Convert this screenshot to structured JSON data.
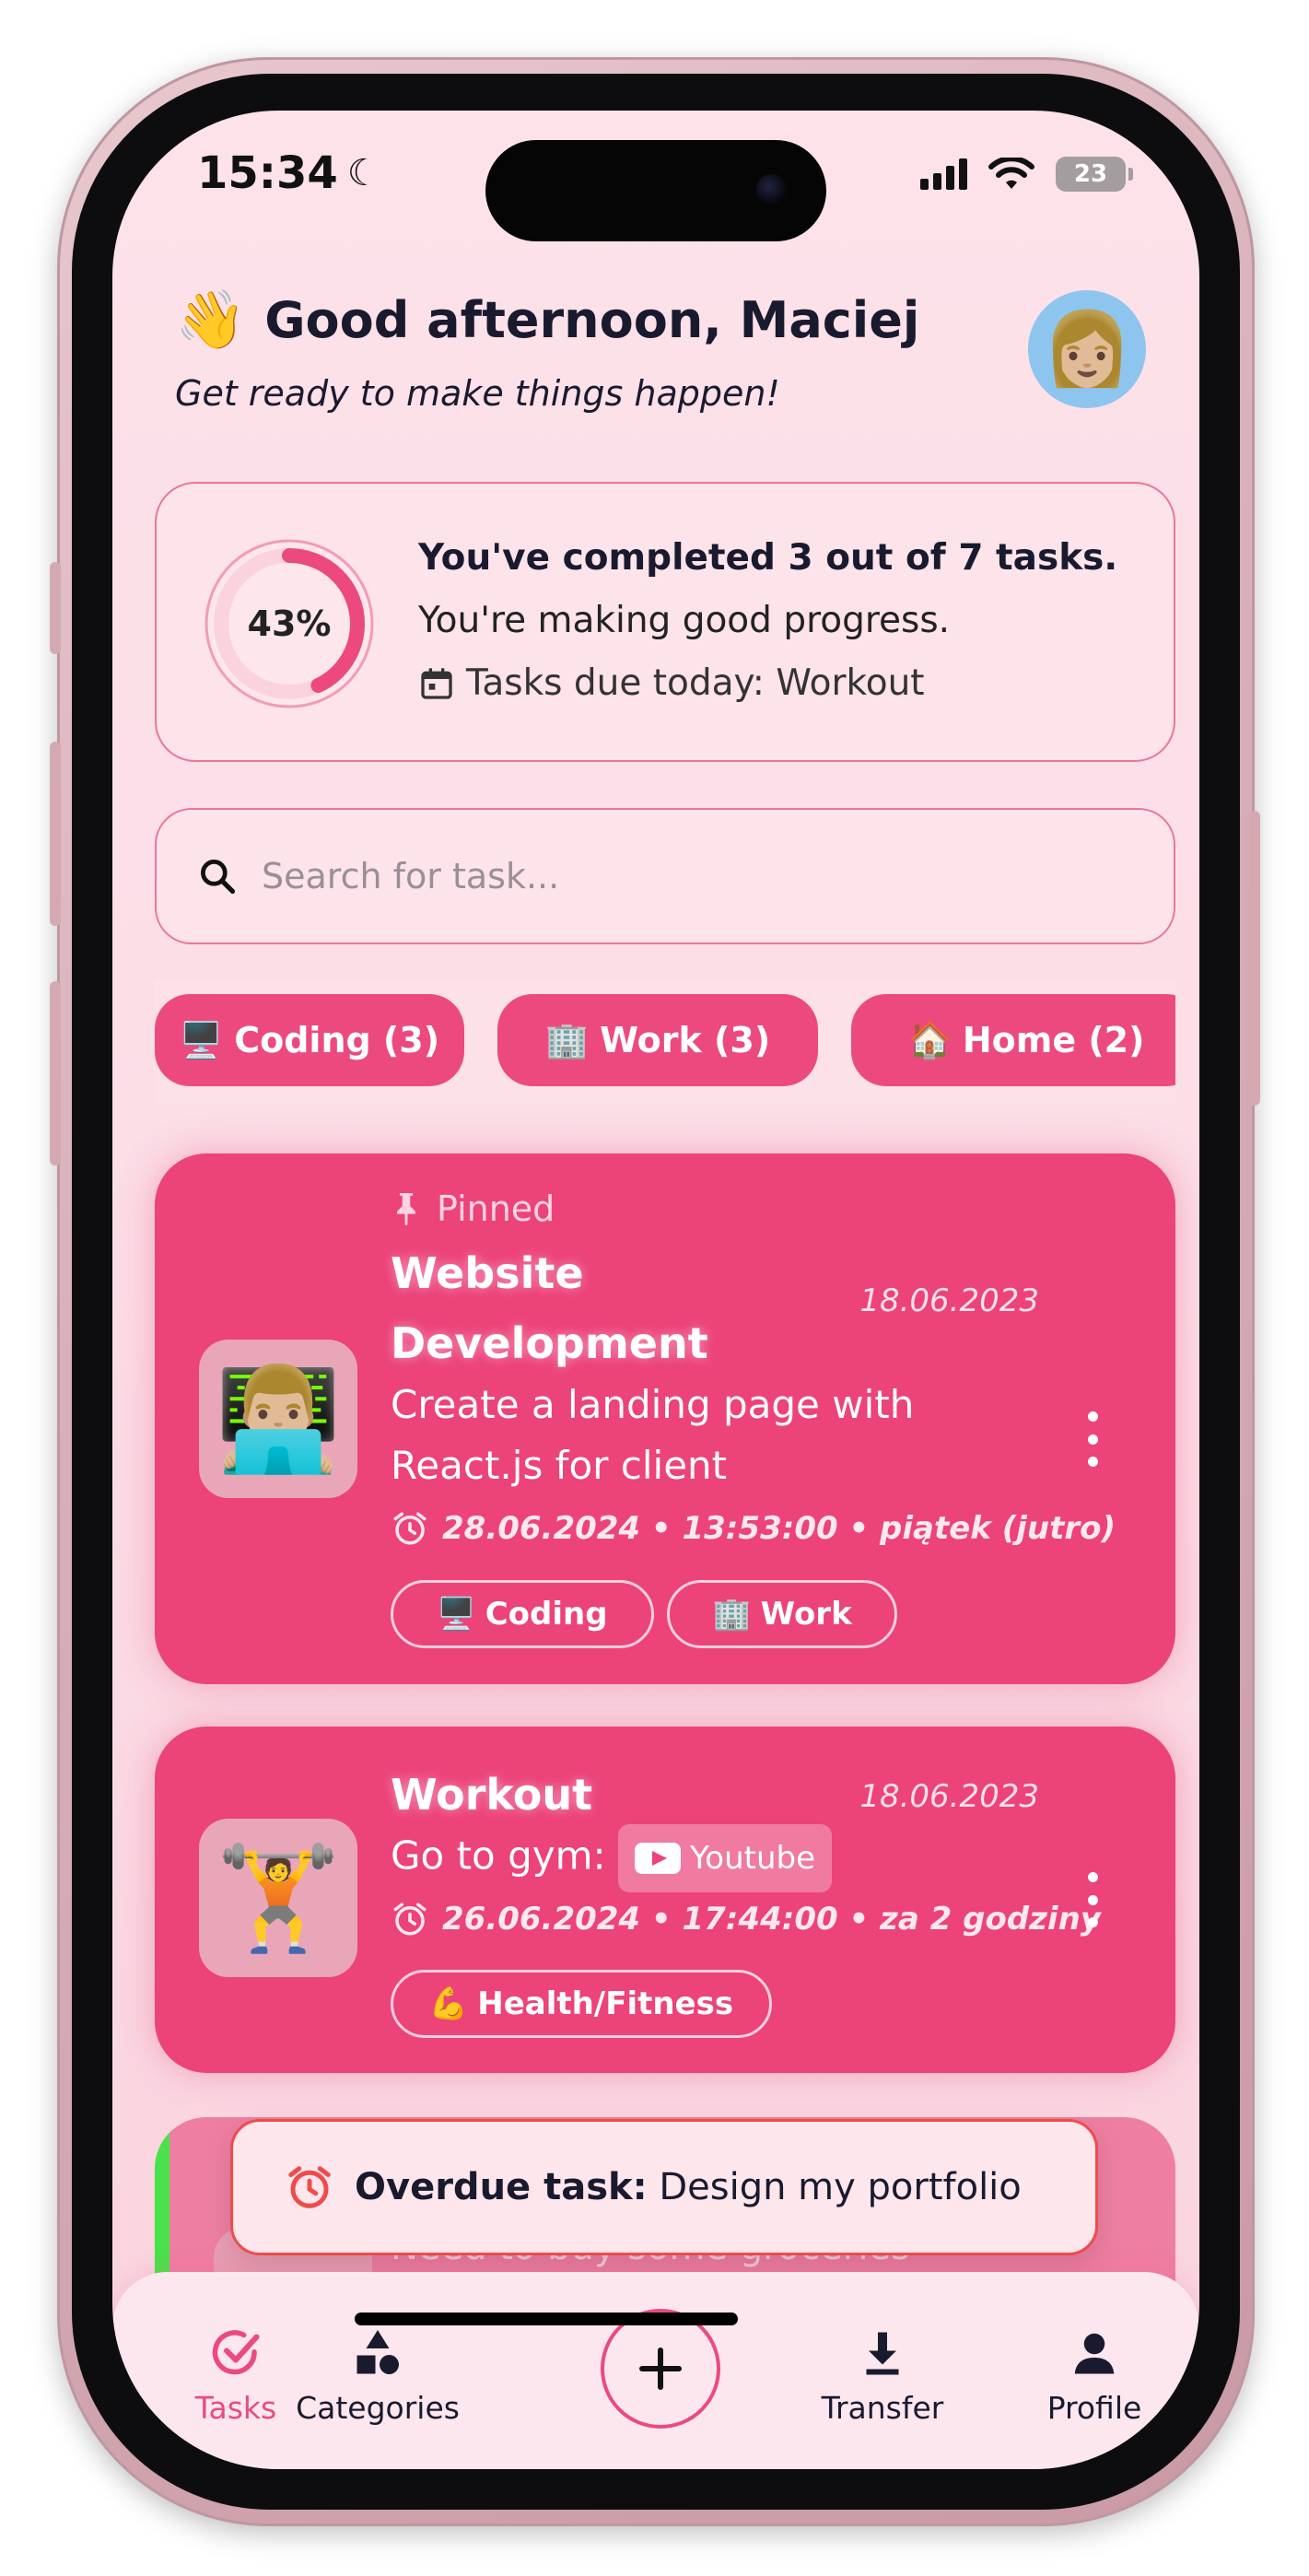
{
  "status_bar": {
    "time": "15:34",
    "battery": "23"
  },
  "header": {
    "greeting": "Good afternoon, Maciej",
    "subtitle": "Get ready to make things happen!",
    "wave_emoji": "👋",
    "avatar_emoji": "👩🏼"
  },
  "progress": {
    "percent_label": "43%",
    "percent_value": 0.43,
    "title": "You've completed 3 out of 7 tasks.",
    "message": "You're making good progress.",
    "due_today": "Tasks due today: Workout",
    "accent": "#ec4a7e"
  },
  "search": {
    "placeholder": "Search for task..."
  },
  "categories": [
    {
      "emoji": "🖥️",
      "label": "Coding (3)"
    },
    {
      "emoji": "🏢",
      "label": "Work (3)"
    },
    {
      "emoji": "🏠",
      "label": "Home (2)"
    }
  ],
  "tasks": [
    {
      "emoji": "👨🏼‍💻",
      "pinned_label": "Pinned",
      "title_line1": "Website",
      "title_line2": "Development",
      "date": "18.06.2023",
      "desc_line1": "Create a landing page with",
      "desc_line2": "React.js for client",
      "due": "28.06.2024 • 13:53:00 • piątek (jutro)",
      "tags": [
        {
          "emoji": "🖥️",
          "label": "Coding"
        },
        {
          "emoji": "🏢",
          "label": "Work"
        }
      ]
    },
    {
      "emoji": "🏋️",
      "title_line1": "Workout",
      "date": "18.06.2023",
      "desc_prefix": "Go to gym:",
      "desc_link": "Youtube",
      "due": "26.06.2024 • 17:44:00 • za 2 godziny",
      "tags": [
        {
          "emoji": "💪",
          "label": "Health/Fitness"
        }
      ]
    }
  ],
  "toast": {
    "bold": "Overdue task:",
    "text": "Design my portfolio"
  },
  "third_task_partial": "Need to buy some groceries",
  "nav": {
    "tasks": "Tasks",
    "categories": "Categories",
    "transfer": "Transfer",
    "profile": "Profile"
  },
  "colors": {
    "brand_pink": "#ec4379",
    "background": "#fde2ea",
    "toast_border": "#f04b4b",
    "stripe_green": "#49e24a"
  }
}
